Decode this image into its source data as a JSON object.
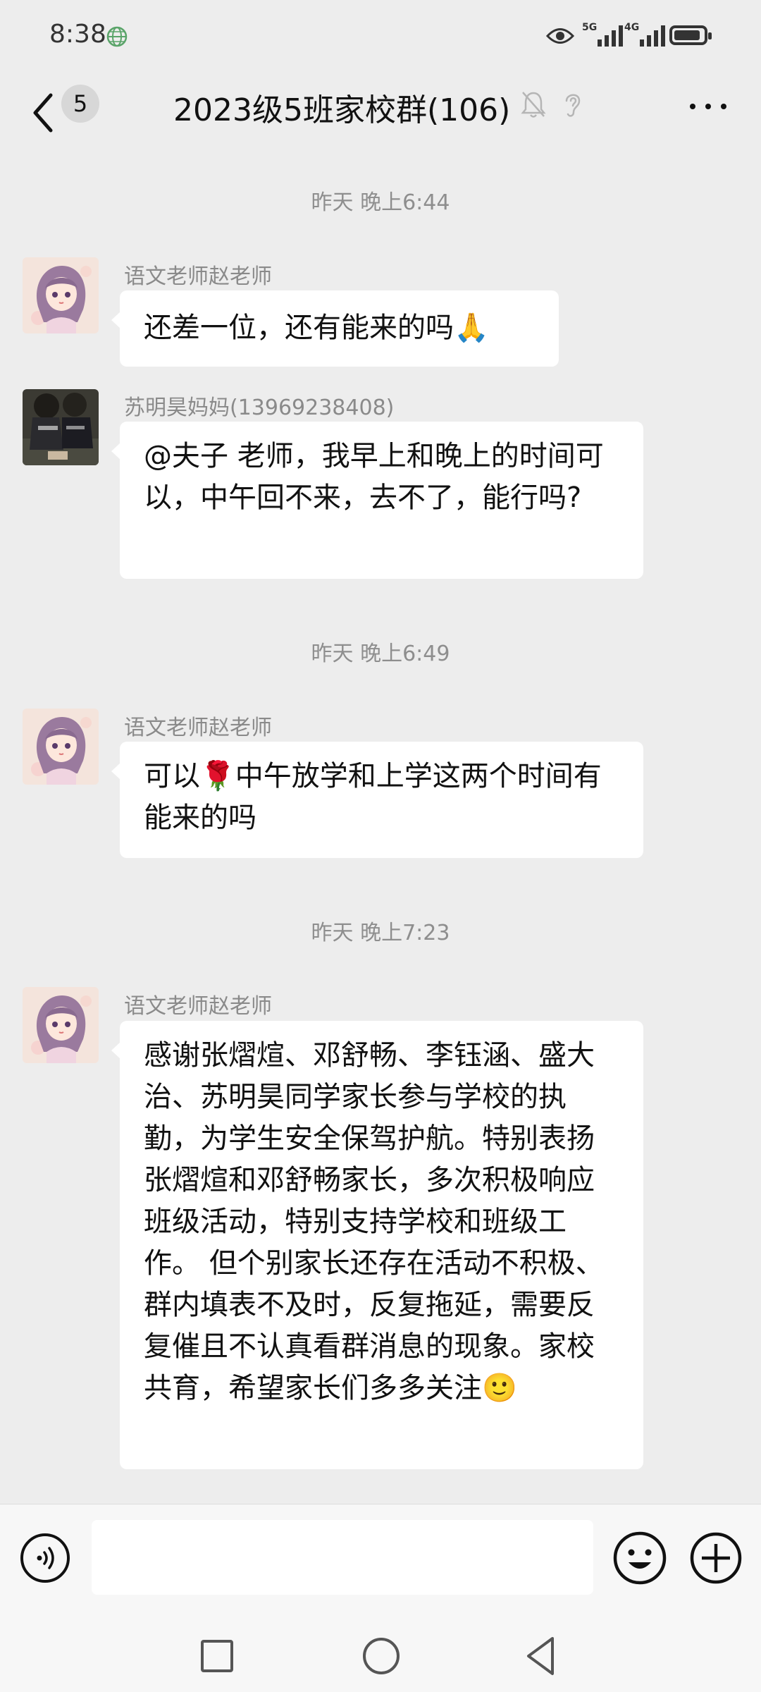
{
  "status_bar": {
    "time": "8:38",
    "signal1_tag": "5G",
    "signal2_tag": "4G",
    "icons": [
      "globe-icon",
      "eye-icon",
      "signal-icon",
      "signal-icon",
      "battery-icon"
    ]
  },
  "header": {
    "unread_count": "5",
    "title": "2023级5班家校群(106)",
    "icons": [
      "back-icon",
      "muted-bell-icon",
      "ear-icon",
      "more-icon"
    ]
  },
  "messages": [
    {
      "timestamp": "昨天 晚上6:44",
      "sender": "语文老师赵老师",
      "text": "还差一位，还有能来的吗🙏"
    },
    {
      "sender": "苏明昊妈妈(13969238408)",
      "text": "@夫子  老师，我早上和晚上的时间可以，中午回不来，去不了，能行吗?"
    },
    {
      "timestamp": "昨天 晚上6:49",
      "sender": "语文老师赵老师",
      "text": "可以🌹中午放学和上学这两个时间有能来的吗"
    },
    {
      "timestamp": "昨天 晚上7:23",
      "sender": "语文老师赵老师",
      "text": "感谢张熠煊、邓舒畅、李钰涵、盛大治、苏明昊同学家长参与学校的执勤，为学生安全保驾护航。特别表扬张熠煊和邓舒畅家长，多次积极响应班级活动，特别支持学校和班级工作。      但个别家长还存在活动不积极、群内填表不及时，反复拖延，需要反复催且不认真看群消息的现象。家校共育，希望家长们多多关注🙂"
    }
  ],
  "input_bar": {
    "placeholder": "",
    "icons": [
      "voice-icon",
      "emoji-icon",
      "plus-icon"
    ]
  },
  "nav_bar": {
    "icons": [
      "recent-apps-icon",
      "home-icon",
      "back-nav-icon"
    ]
  },
  "colors": {
    "background": "#ededed",
    "bubble": "#ffffff",
    "timestamp": "#8e8e8e",
    "sender": "#8a8a8a"
  }
}
